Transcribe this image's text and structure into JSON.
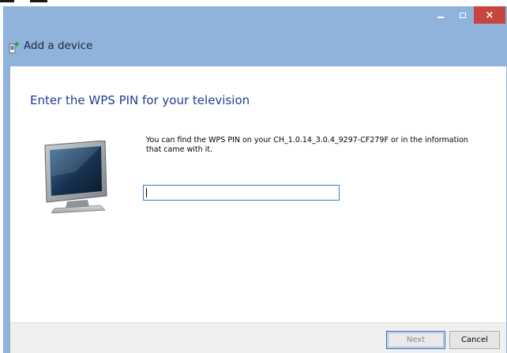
{
  "window": {
    "title": "Add a device",
    "caption_buttons": {
      "minimize_icon": "minimize-icon",
      "maximize_icon": "maximize-icon",
      "close_label": "×"
    },
    "colors": {
      "frame": "#8fb3da",
      "close": "#c7453f",
      "heading": "#1e3f8f"
    }
  },
  "content": {
    "heading": "Enter the WPS PIN for your television",
    "description": "You can find the WPS PIN on your CH_1.0.14_3.0.4_9297-CF279F or in the information that came with it.",
    "pin_value": "",
    "device_icon": "television-icon"
  },
  "footer": {
    "next_label": "Next",
    "cancel_label": "Cancel"
  }
}
